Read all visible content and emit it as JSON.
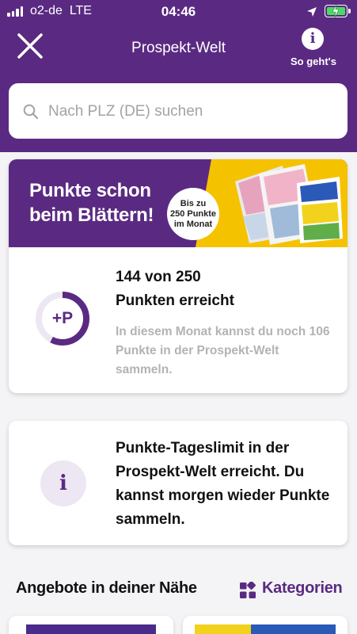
{
  "status_bar": {
    "carrier": "o2-de",
    "network": "LTE",
    "time": "04:46",
    "icons": [
      "signal-icon",
      "location-arrow-icon",
      "battery-charging-icon"
    ]
  },
  "nav": {
    "title": "Prospekt-Welt",
    "close_icon": "close-icon",
    "help_icon": "info-icon",
    "help_label": "So geht's"
  },
  "search": {
    "placeholder": "Nach PLZ (DE) suchen",
    "icon": "search-icon"
  },
  "points_card": {
    "banner_line1": "Punkte schon",
    "banner_line2": "beim Blättern!",
    "badge_line1": "Bis zu",
    "badge_line2": "250 Punkte",
    "badge_line3": "im Monat",
    "ring_label": "+P",
    "progress_value": 144,
    "progress_max": 250,
    "title_line1": "144 von 250",
    "title_line2": "Punkten erreicht",
    "description": "In diesem Monat kannst du noch 106 Punkte in der Prospekt-Welt sammeln."
  },
  "limit_card": {
    "icon": "info-icon",
    "text": "Punkte-Tageslimit in der Prospekt-Welt erreicht. Du kannst morgen wieder Punkte sammeln."
  },
  "offers_section": {
    "title": "Angebote in deiner Nähe",
    "categories_label": "Kategorien",
    "categories_icon": "grid-icon"
  },
  "colors": {
    "brand_purple": "#5a2a82",
    "ring_track": "#ece7f2",
    "muted_text": "#b3b3b3",
    "battery_green": "#4cd964"
  }
}
